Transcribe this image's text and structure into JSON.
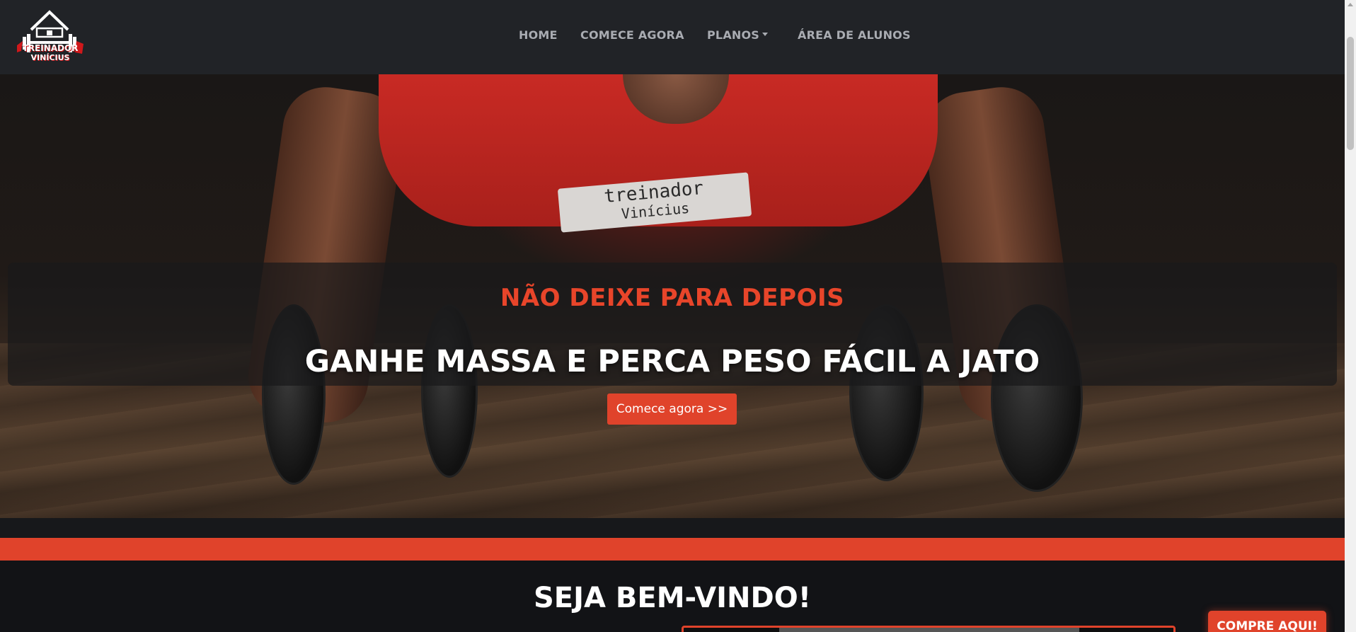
{
  "brand": {
    "logo_alt": "Treinador Vinícius",
    "logo_line1": "TREINADOR",
    "logo_line2": "VINÍCIUS"
  },
  "nav": {
    "items": [
      {
        "label": "HOME"
      },
      {
        "label": "COMECE AGORA"
      },
      {
        "label": "PLANOS",
        "dropdown": true
      },
      {
        "label": "ÁREA DE ALUNOS"
      }
    ]
  },
  "hero": {
    "subtitle": "NÃO DEIXE PARA DEPOIS",
    "title": "GANHE MASSA E PERCA PESO FÁCIL A JATO",
    "button_label": "Comece agora >>",
    "shirt_text_line1": "treinador",
    "shirt_text_line2": "Vinícius"
  },
  "welcome": {
    "title": "SEJA BEM-VINDO!"
  },
  "cta": {
    "label": "COMPRE AQUI!"
  },
  "colors": {
    "accent": "#e0432b",
    "navbar_bg": "#212327",
    "page_bg": "#121316",
    "nav_text": "#a9acb2"
  }
}
